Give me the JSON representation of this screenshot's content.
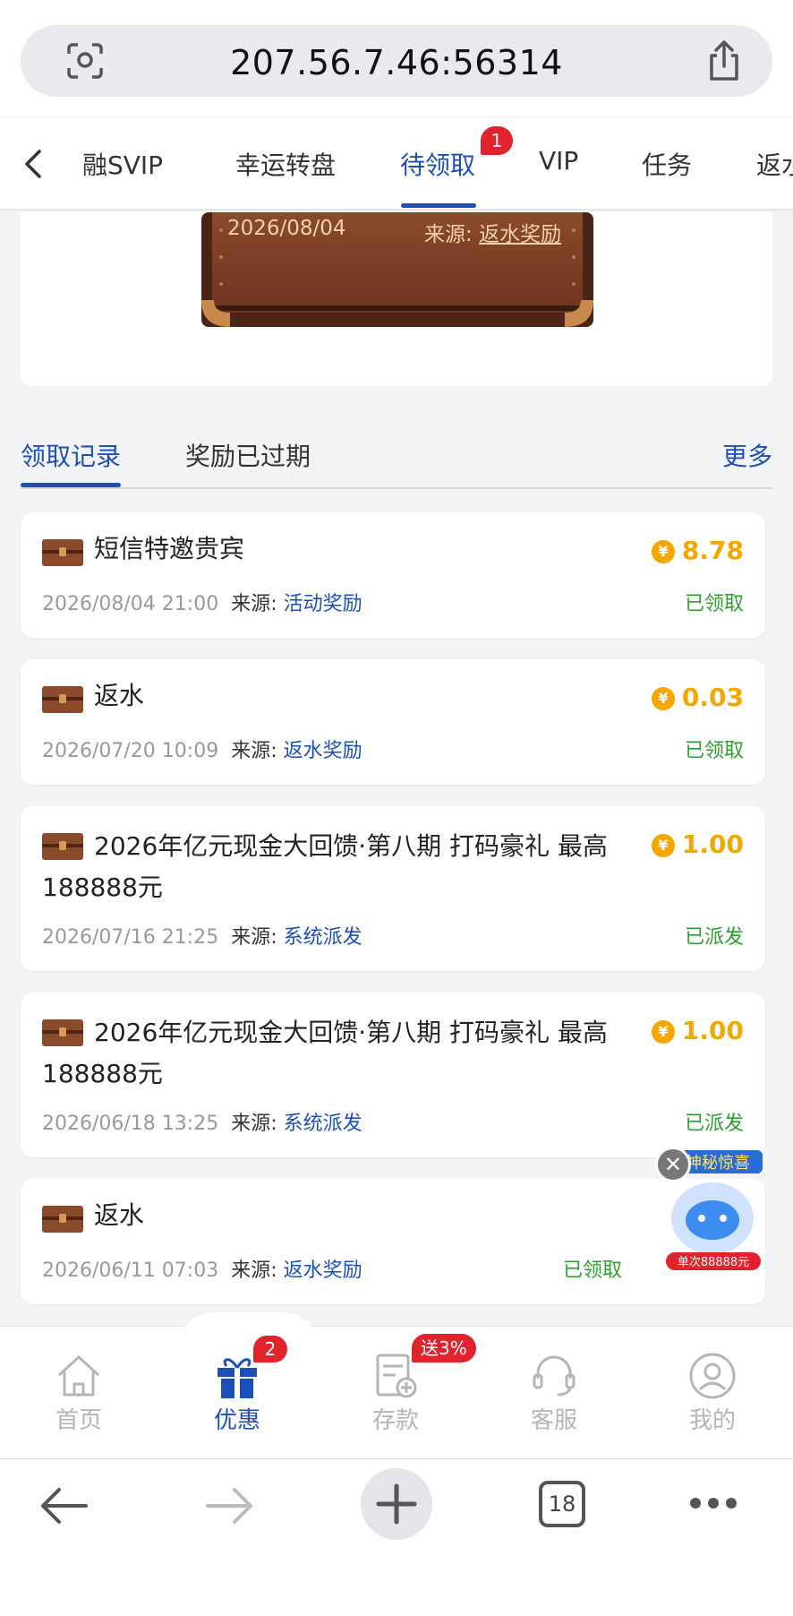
{
  "browser": {
    "url": "207.56.7.46:56314",
    "toolbar": {
      "tab_count": "18"
    }
  },
  "category_tabs": {
    "items": [
      "融SVIP",
      "幸运转盘",
      "待领取",
      "VIP",
      "任务",
      "返水"
    ],
    "active_index": 2,
    "badge": "1"
  },
  "hero": {
    "date": "2026/08/04",
    "source_label": "来源:",
    "source_value": "返水奖励"
  },
  "record_tabs": {
    "items": [
      "领取记录",
      "奖励已过期"
    ],
    "more": "更多"
  },
  "records": [
    {
      "title": "短信特邀贵宾",
      "amount": "8.78",
      "datetime": "2026/08/04 21:00",
      "source_label": "来源:",
      "source": "活动奖励",
      "status": "已领取"
    },
    {
      "title": "返水",
      "amount": "0.03",
      "datetime": "2026/07/20 10:09",
      "source_label": "来源:",
      "source": "返水奖励",
      "status": "已领取"
    },
    {
      "title_line1": "2026年亿元现金大回馈·第八期 打码豪礼 最高",
      "title_line2": "188888元",
      "amount": "1.00",
      "datetime": "2026/07/16 21:25",
      "source_label": "来源:",
      "source": "系统派发",
      "status": "已派发"
    },
    {
      "title_line1": "2026年亿元现金大回馈·第八期 打码豪礼 最高",
      "title_line2": "188888元",
      "amount": "1.00",
      "datetime": "2026/06/18 13:25",
      "source_label": "来源:",
      "source": "系统派发",
      "status": "已派发"
    },
    {
      "title": "返水",
      "datetime": "2026/06/11 07:03",
      "source_label": "来源:",
      "source": "返水奖励",
      "status": "已领取"
    }
  ],
  "promo": {
    "banner_text": "神秘惊喜",
    "sub_text": "单次88888元"
  },
  "bottom_nav": {
    "items": [
      "首页",
      "优惠",
      "存款",
      "客服",
      "我的"
    ],
    "active_index": 1,
    "promo_badge": "2",
    "deposit_badge": "送3%"
  },
  "colors": {
    "accent": "#1d4fb8",
    "gold": "#f4a700",
    "success": "#2f9e2f",
    "badge": "#e0232c"
  }
}
